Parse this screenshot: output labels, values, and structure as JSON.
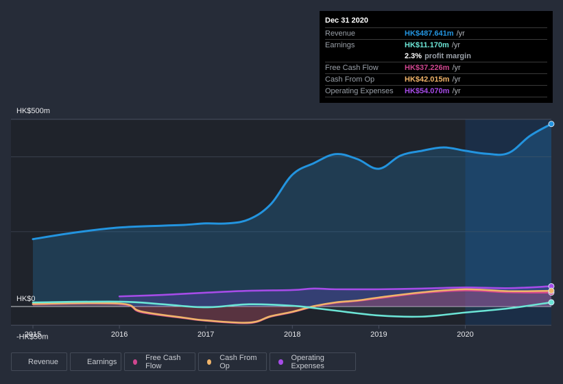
{
  "tooltip": {
    "date": "Dec 31 2020",
    "rows": [
      {
        "label": "Revenue",
        "value": "HK$487.641m",
        "unit": "/yr",
        "color": "#2394df"
      },
      {
        "label": "Earnings",
        "value": "HK$11.170m",
        "unit": "/yr",
        "color": "#6ce5d6"
      },
      {
        "label": "",
        "value": "2.3%",
        "unit": "profit margin",
        "color": "#ffffff"
      },
      {
        "label": "Free Cash Flow",
        "value": "HK$37.226m",
        "unit": "/yr",
        "color": "#d0468f"
      },
      {
        "label": "Cash From Op",
        "value": "HK$42.015m",
        "unit": "/yr",
        "color": "#f0b46a"
      },
      {
        "label": "Operating Expenses",
        "value": "HK$54.070m",
        "unit": "/yr",
        "color": "#a64ce8"
      }
    ]
  },
  "legend": [
    {
      "label": "Revenue",
      "color": "#2394df"
    },
    {
      "label": "Earnings",
      "color": "#6ce5d6"
    },
    {
      "label": "Free Cash Flow",
      "color": "#d0468f"
    },
    {
      "label": "Cash From Op",
      "color": "#f0b46a"
    },
    {
      "label": "Operating Expenses",
      "color": "#a64ce8"
    }
  ],
  "chart_data": {
    "type": "area",
    "title": "",
    "xlabel": "",
    "ylabel": "",
    "y_tick_labels": [
      "HK$500m",
      "HK$0",
      "-HK$50m"
    ],
    "y_ticks": [
      500,
      0,
      -50
    ],
    "ylim": [
      -50,
      500
    ],
    "x_tick_labels": [
      "2015",
      "2016",
      "2017",
      "2018",
      "2019",
      "2020"
    ],
    "x_ticks": [
      2015,
      2016,
      2017,
      2018,
      2019,
      2020
    ],
    "xlim": [
      2014.74,
      2021.0
    ],
    "gridlines_y": [
      200,
      400
    ],
    "highlight_range": [
      2020.0,
      2021.0
    ],
    "legend_position": "bottom-left",
    "series": [
      {
        "name": "Revenue",
        "color": "#2394df",
        "x": [
          2015.0,
          2015.5,
          2016.0,
          2016.5,
          2016.75,
          2017.0,
          2017.25,
          2017.5,
          2017.75,
          2018.0,
          2018.25,
          2018.5,
          2018.75,
          2019.0,
          2019.25,
          2019.5,
          2019.75,
          2020.0,
          2020.25,
          2020.5,
          2020.75,
          2021.0
        ],
        "values": [
          180,
          198,
          211,
          216,
          218,
          222,
          222,
          233,
          273,
          352,
          383,
          407,
          394,
          368,
          403,
          416,
          425,
          416,
          408,
          410,
          456,
          487.641
        ]
      },
      {
        "name": "Earnings",
        "color": "#6ce5d6",
        "x": [
          2015.0,
          2016.0,
          2016.5,
          2017.0,
          2017.5,
          2018.0,
          2018.25,
          2018.5,
          2019.0,
          2019.5,
          2020.0,
          2020.5,
          2021.0
        ],
        "values": [
          11,
          13,
          6,
          -2,
          6,
          2,
          -4,
          -11,
          -24,
          -27,
          -16,
          -5,
          11.17
        ]
      },
      {
        "name": "Free Cash Flow",
        "color": "#d0468f",
        "x": [
          2015.0,
          2016.0,
          2016.25,
          2016.75,
          2017.0,
          2017.5,
          2017.75,
          2018.0,
          2018.25,
          2018.5,
          2018.75,
          2019.0,
          2019.5,
          2020.0,
          2020.5,
          2021.0
        ],
        "values": [
          6,
          7,
          -15,
          -31,
          -38,
          -44,
          -27,
          -15,
          0,
          10,
          15,
          22,
          36,
          43,
          38,
          37.226
        ]
      },
      {
        "name": "Cash From Op",
        "color": "#f0b46a",
        "x": [
          2015.0,
          2016.0,
          2016.25,
          2016.75,
          2017.0,
          2017.5,
          2017.75,
          2018.0,
          2018.25,
          2018.5,
          2018.75,
          2019.0,
          2019.5,
          2020.0,
          2020.5,
          2021.0
        ],
        "values": [
          7,
          8,
          -13,
          -30,
          -37,
          -43,
          -26,
          -14,
          1,
          11,
          16,
          24,
          38,
          46,
          41,
          42.015
        ]
      },
      {
        "name": "Operating Expenses",
        "color": "#a64ce8",
        "x": [
          2016.0,
          2016.5,
          2017.0,
          2017.5,
          2018.0,
          2018.25,
          2018.5,
          2019.0,
          2019.5,
          2020.0,
          2020.5,
          2021.0
        ],
        "values": [
          27,
          31,
          37,
          42,
          44,
          48,
          46,
          46,
          48,
          51,
          49,
          54.07
        ]
      }
    ]
  }
}
